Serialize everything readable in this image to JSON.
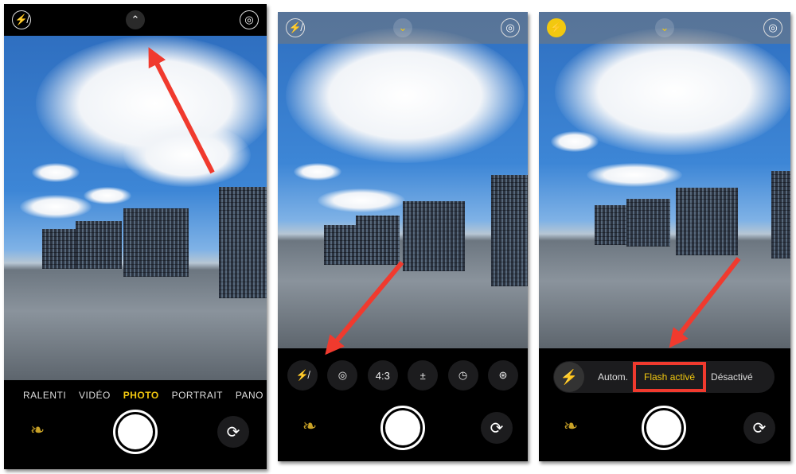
{
  "colors": {
    "accent": "#f2c80f",
    "annotation": "#f03a2e"
  },
  "panel1": {
    "top": {
      "flash_icon": "flash-off-icon",
      "chevron_icon": "chevron-up-icon",
      "live_icon": "live-photo-icon"
    },
    "modes": [
      "RALENTI",
      "VIDÉO",
      "PHOTO",
      "PORTRAIT",
      "PANO"
    ],
    "active_mode": "PHOTO"
  },
  "panel2": {
    "options": [
      {
        "icon": "flash-off-icon",
        "label": ""
      },
      {
        "icon": "live-photo-icon",
        "label": ""
      },
      {
        "icon": "aspect-ratio",
        "label": "4:3"
      },
      {
        "icon": "exposure-icon",
        "label": "±"
      },
      {
        "icon": "timer-icon",
        "label": ""
      },
      {
        "icon": "filters-icon",
        "label": ""
      }
    ]
  },
  "panel3": {
    "flash_options": [
      "Autom.",
      "Flash activé",
      "Désactivé"
    ],
    "selected": "Flash activé"
  }
}
